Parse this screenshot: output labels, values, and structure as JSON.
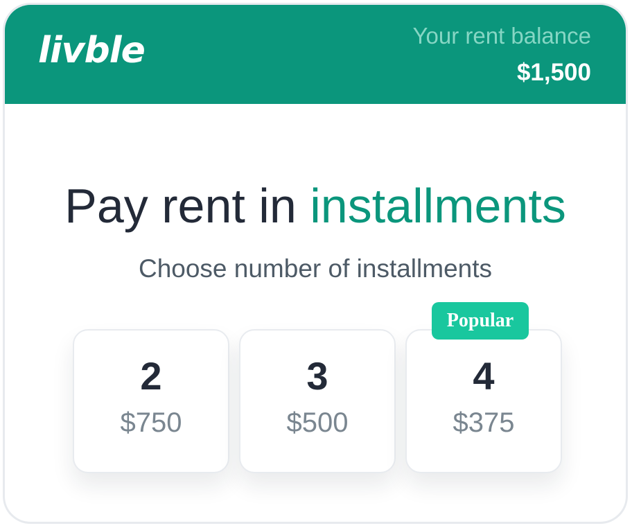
{
  "header": {
    "logo_text": "livble",
    "balance_label": "Your rent balance",
    "balance_amount": "$1,500"
  },
  "main": {
    "title_prefix": "Pay rent in ",
    "title_accent": "installments",
    "subtitle": "Choose number of installments",
    "options": [
      {
        "count": "2",
        "amount": "$750"
      },
      {
        "count": "3",
        "amount": "$500"
      },
      {
        "count": "4",
        "amount": "$375",
        "badge": "Popular"
      }
    ]
  },
  "colors": {
    "brand": "#0b967c",
    "badge": "#19c79e",
    "title_text": "#232a38",
    "muted_text": "#7a8690"
  }
}
